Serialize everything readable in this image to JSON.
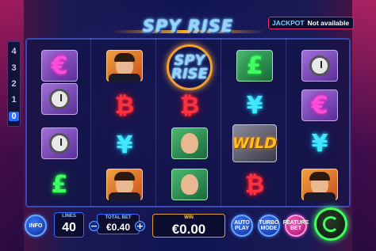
{
  "title": "SPY RISE",
  "jackpot": {
    "label": "JACKPOT",
    "value": "Not available"
  },
  "lines_indicator": [
    "4",
    "3",
    "2",
    "1",
    "0"
  ],
  "symbols": {
    "euro": "€",
    "pound": "£",
    "bitcoin": "₿",
    "yen": "¥",
    "wild": "WILD",
    "spy_rise": [
      "SPY",
      "RISE"
    ]
  },
  "controls": {
    "info": "INFO",
    "lines_label": "LINES",
    "lines_value": "40",
    "total_bet_label": "TOTAL BET",
    "total_bet_value": "€0.40",
    "minus": "−",
    "plus": "+",
    "win_label": "WIN",
    "win_value": "€0.00",
    "autoplay": "AUTO PLAY",
    "turbo": "TURBO MODE",
    "feature_bet": "FEATURE BET"
  },
  "colors": {
    "accent_blue": "#3a7aff",
    "neon_green": "#40ff60",
    "neon_pink": "#ff4dd8",
    "jackpot_border": "#e02a6a"
  }
}
